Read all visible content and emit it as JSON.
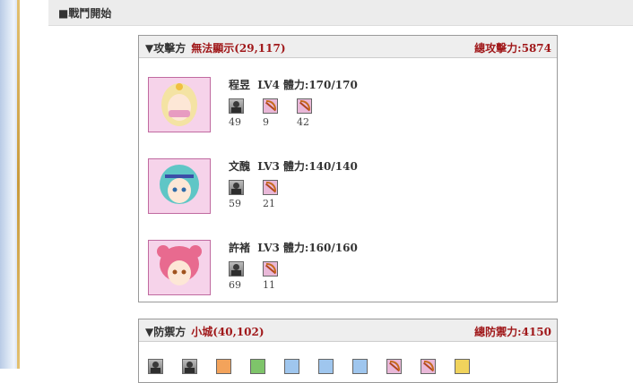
{
  "header": {
    "title": "■戰鬥開始"
  },
  "attack": {
    "side_label": "▼攻擊方",
    "location": "無法顯示(29,117)",
    "total_label": "總攻擊力:",
    "total_value": "5874",
    "generals": [
      {
        "name": "程昱",
        "level": "LV4",
        "hp_label": "體力:",
        "hp": "170/170",
        "units": [
          {
            "type": "soldier",
            "count": "49"
          },
          {
            "type": "bow",
            "count": "9"
          },
          {
            "type": "bow",
            "count": "42"
          }
        ]
      },
      {
        "name": "文醜",
        "level": "LV3",
        "hp_label": "體力:",
        "hp": "140/140",
        "units": [
          {
            "type": "soldier",
            "count": "59"
          },
          {
            "type": "bow",
            "count": "21"
          }
        ]
      },
      {
        "name": "許褚",
        "level": "LV3",
        "hp_label": "體力:",
        "hp": "160/160",
        "units": [
          {
            "type": "soldier",
            "count": "69"
          },
          {
            "type": "bow",
            "count": "11"
          }
        ]
      }
    ]
  },
  "defense": {
    "side_label": "▼防禦方",
    "location": "小城(40,102)",
    "total_label": "總防禦力:",
    "total_value": "4150",
    "unit_icons": [
      "soldier-icon",
      "soldier-icon",
      "orange-icon",
      "green-icon",
      "spear-icon",
      "spear-icon",
      "spear-icon",
      "bow-icon",
      "bow-icon",
      "yellow-icon"
    ]
  }
}
